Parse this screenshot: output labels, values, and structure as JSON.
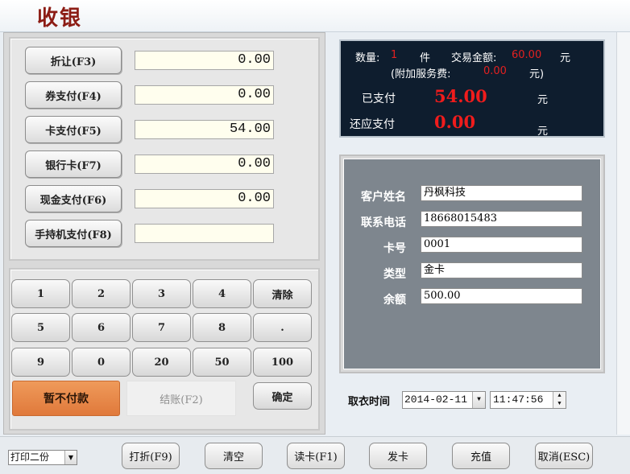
{
  "window": {
    "title": "收银"
  },
  "payments": [
    {
      "label": "折让(F3)",
      "value": "0.00"
    },
    {
      "label": "券支付(F4)",
      "value": "0.00"
    },
    {
      "label": "卡支付(F5)",
      "value": "54.00"
    },
    {
      "label": "银行卡(F7)",
      "value": "0.00"
    },
    {
      "label": "现金支付(F6)",
      "value": "0.00"
    },
    {
      "label": "手持机支付(F8)",
      "value": ""
    }
  ],
  "keypad": {
    "keys": [
      "1",
      "2",
      "3",
      "4",
      "清除",
      "5",
      "6",
      "7",
      "8",
      ".",
      "9",
      "0",
      "20",
      "50",
      "100"
    ],
    "hold_label": "暂不付款",
    "settle_label": "结账(F2)",
    "confirm_label": "确定"
  },
  "summary": {
    "qty_label": "数量:",
    "qty": "1",
    "qty_unit": "件",
    "amount_label": "交易金额:",
    "amount": "60.00",
    "yuan": "元",
    "service_label": "(附加服务费:",
    "service": "0.00",
    "service_unit": "元)",
    "paid_label": "已支付",
    "paid": "54.00",
    "due_label": "还应支付",
    "due": "0.00"
  },
  "customer": {
    "name_label": "客户姓名",
    "name": "丹枫科技",
    "phone_label": "联系电话",
    "phone": "18668015483",
    "card_label": "卡号",
    "card": "0001",
    "type_label": "类型",
    "type": "金卡",
    "balance_label": "余额",
    "balance": "500.00"
  },
  "pickup": {
    "label": "取衣时间",
    "date": "2014-02-11",
    "time": "11:47:56"
  },
  "footer": {
    "print_option": "打印二份",
    "buttons": [
      "打折(F9)",
      "清空",
      "读卡(F1)",
      "发卡",
      "充值",
      "取消(ESC)"
    ]
  },
  "colors": {
    "title": "#8c1c14",
    "summary_bg": "#0e1d2e",
    "amount_red": "#f01c1c",
    "hold_btn": "#e0793b"
  }
}
